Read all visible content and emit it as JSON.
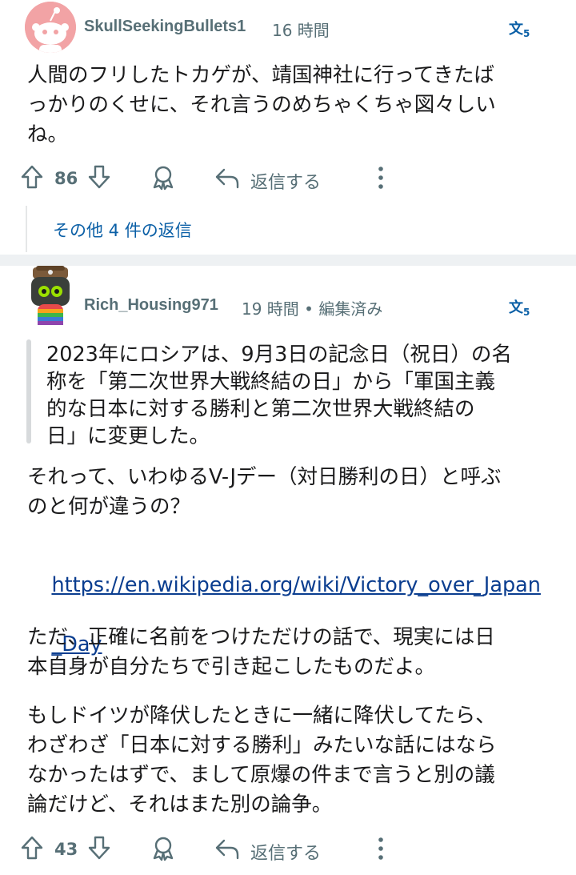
{
  "comments": [
    {
      "username": "SkullSeekingBullets1",
      "time": "16 時間",
      "body": "人間のフリしたトカゲが、靖国神社に行ってきたば\nっかりのくせに、それ言うのめちゃくちゃ図々しい\nね。",
      "votes": "86",
      "reply_label": "返信する",
      "more_replies": "その他 4 件の返信"
    },
    {
      "username": "Rich_Housing971",
      "time": "19 時間 • 編集済み",
      "quote": "2023年にロシアは、9月3日の記念日（祝日）の名\n称を「第二次世界大戦終結の日」から「軍国主義\n的な日本に対する勝利と第二次世界大戦終結の\n日」に変更した。",
      "para1": "それって、いわゆるV-Jデー（対日勝利の日）と呼ぶ\nのと何が違うの？",
      "link_line1": "https://en.wikipedia.org/wiki/Victory_over_Japan",
      "link_line2": "_Day",
      "para2": "ただ、正確に名前をつけただけの話で、現実には日\n本自身が自分たちで引き起こしたものだよ。",
      "para3": "もしドイツが降伏したときに一緒に降伏してたら、\nわざわざ「日本に対する勝利」みたいな話にはなら\nなかったはずで、まして原爆の件まで言うと別の議\n論だけど、それはまた別の論争。",
      "votes": "43",
      "reply_label": "返信する"
    }
  ],
  "icons": {
    "translate": "文",
    "translate_sub": "5"
  },
  "colors": {
    "meta": "#576f76",
    "link": "#0a3d8f",
    "accent_blue": "#0a5fa6",
    "separator": "#eef1f3"
  }
}
